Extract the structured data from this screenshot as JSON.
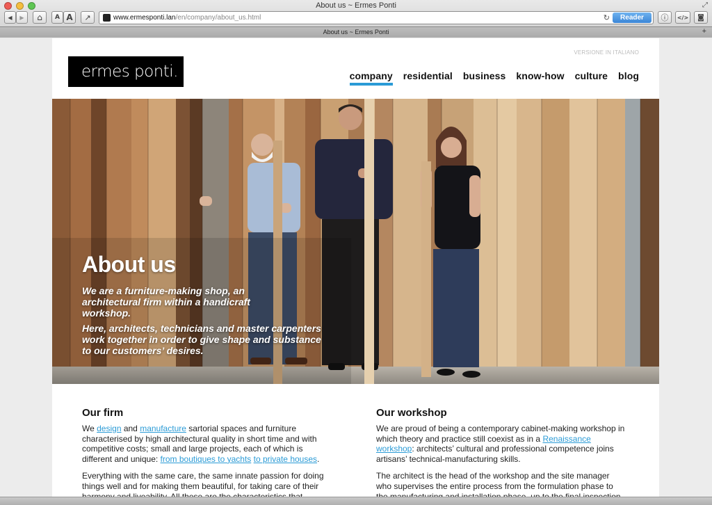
{
  "window": {
    "title": "About us ~ Ermes Ponti",
    "tab_title": "About us ~ Ermes Ponti"
  },
  "toolbar": {
    "back_icon": "◀",
    "forward_icon": "▶",
    "home_icon": "⌂",
    "font_small": "A",
    "font_large": "A",
    "share_icon": "↗",
    "url_host": "www.ermesponti.lan",
    "url_path": "/en/company/about_us.html",
    "reload_icon": "↻",
    "reader_label": "Reader",
    "info_icon": "ⓘ",
    "code_icon": "</>",
    "screenshot_icon": "◙",
    "new_tab_icon": "+",
    "resize_icon": "⤢"
  },
  "site": {
    "logo_text": "ermes ponti.",
    "language_link": "VERSIONE IN ITALIANO",
    "accent_color": "#2b9bd6",
    "nav": [
      {
        "label": "company",
        "active": true
      },
      {
        "label": "residential"
      },
      {
        "label": "business"
      },
      {
        "label": "know-how"
      },
      {
        "label": "culture"
      },
      {
        "label": "blog"
      }
    ]
  },
  "hero": {
    "title": "About us",
    "paragraph_1": "We are a furniture-making shop, an architectural firm within a handicraft workshop.",
    "paragraph_2": "Here, architects, technicians and master carpenters work together in order to give shape and substance to our customers’ desires."
  },
  "sections": {
    "firm": {
      "heading": "Our firm",
      "p1_we": "We ",
      "p1_link_design": "design",
      "p1_and": " and ",
      "p1_link_manufacture": "manufacture",
      "p1_rest": " sartorial spaces and furniture characterised by high architectural quality in short time and with competitive costs; small and large projects, each of which is different and unique: ",
      "p1_link_boutiques": "from boutiques to yachts",
      "p1_space": " ",
      "p1_link_private": "to private houses",
      "p1_end": ".",
      "p2": "Everything with the same care, the same innate passion for doing things well and for making them beautiful, for taking care of their harmony and liveability. All these are the characteristics that represent"
    },
    "workshop": {
      "heading": "Our workshop",
      "p1_start": "We are proud of being a contemporary cabinet-making workshop in which theory and practice still coexist as in a ",
      "p1_link_renaissance": "Renaissance workshop",
      "p1_end": ": architects’ cultural and professional competence joins artisans’ technical-manufacturing skills.",
      "p2": "The architect is the head of the workshop and the site manager who supervises the entire process from the formulation phase to the manufacturing and installation phase, up to the final inspection in a"
    }
  }
}
